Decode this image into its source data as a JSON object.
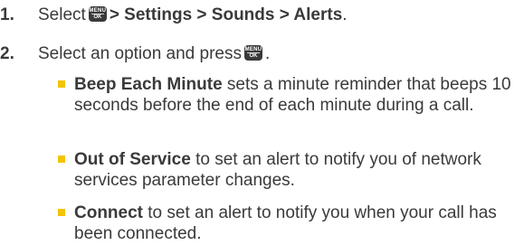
{
  "steps": [
    {
      "number": "1.",
      "prefix": "Select",
      "key_icon": {
        "name": "menu-ok-key",
        "top_label": "MENU",
        "bottom_label": "OK"
      },
      "path": "> Settings > Sounds > Alerts",
      "suffix": "."
    },
    {
      "number": "2.",
      "prefix": "Select an option and press",
      "key_icon": {
        "name": "menu-ok-key",
        "top_label": "MENU",
        "bottom_label": "OK"
      },
      "suffix": "."
    }
  ],
  "options": [
    {
      "term": "Beep Each Minute",
      "description": " sets a minute reminder that beeps 10 seconds before the end of each minute during a call."
    },
    {
      "term": "Out of Service",
      "description": " to set an alert to notify you of network services parameter changes."
    },
    {
      "term": "Connect",
      "description": " to set an alert to notify you when your call has been connected."
    }
  ],
  "colors": {
    "text": "#3a3a3a",
    "bullet": "#f3c400",
    "key_icon": "#3a3a3a"
  }
}
